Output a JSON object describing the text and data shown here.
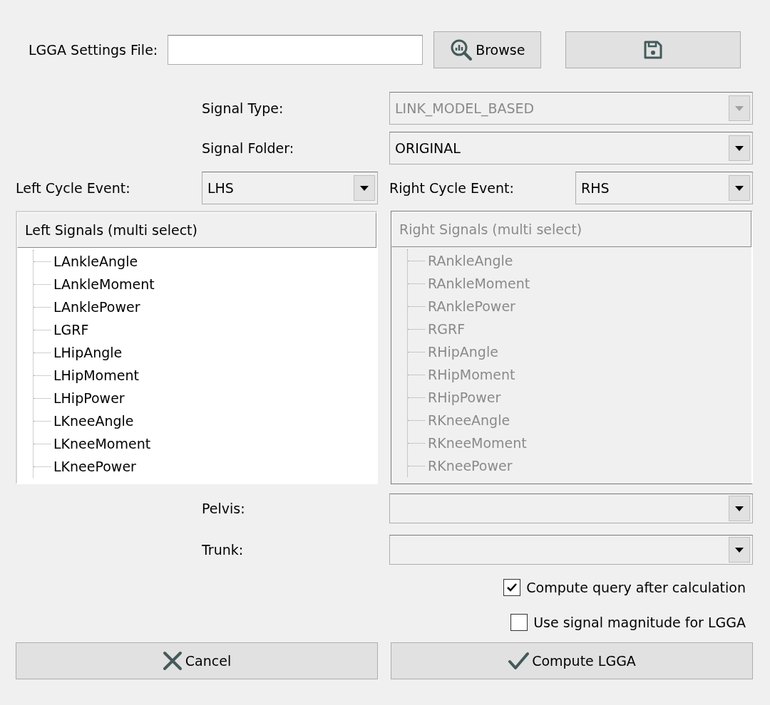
{
  "settings_file": {
    "label": "LGGA Settings File:",
    "browse_button": "Browse"
  },
  "signal_type": {
    "label": "Signal Type:",
    "value": "LINK_MODEL_BASED",
    "disabled": true
  },
  "signal_folder": {
    "label": "Signal Folder:",
    "value": "ORIGINAL",
    "disabled": false
  },
  "left_cycle_event": {
    "label": "Left Cycle Event:",
    "value": "LHS",
    "disabled": false
  },
  "right_cycle_event": {
    "label": "Right Cycle Event:",
    "value": "RHS",
    "disabled": false
  },
  "left_signals": {
    "header": "Left Signals (multi select)",
    "disabled": false,
    "items": [
      "LAnkleAngle",
      "LAnkleMoment",
      "LAnklePower",
      "LGRF",
      "LHipAngle",
      "LHipMoment",
      "LHipPower",
      "LKneeAngle",
      "LKneeMoment",
      "LKneePower"
    ]
  },
  "right_signals": {
    "header": "Right Signals (multi select)",
    "disabled": true,
    "items": [
      "RAnkleAngle",
      "RAnkleMoment",
      "RAnklePower",
      "RGRF",
      "RHipAngle",
      "RHipMoment",
      "RHipPower",
      "RKneeAngle",
      "RKneeMoment",
      "RKneePower"
    ]
  },
  "pelvis": {
    "label": "Pelvis:",
    "disabled": false
  },
  "trunk": {
    "label": "Trunk:",
    "disabled": false
  },
  "options": [
    {
      "label": "Compute query after calculation",
      "checked": true
    },
    {
      "label": "Use signal magnitude for LGGA",
      "checked": false
    }
  ],
  "buttons": [
    {
      "kind": "cancel",
      "label": "Cancel"
    },
    {
      "kind": "ok",
      "label": "Compute LGGA"
    }
  ]
}
